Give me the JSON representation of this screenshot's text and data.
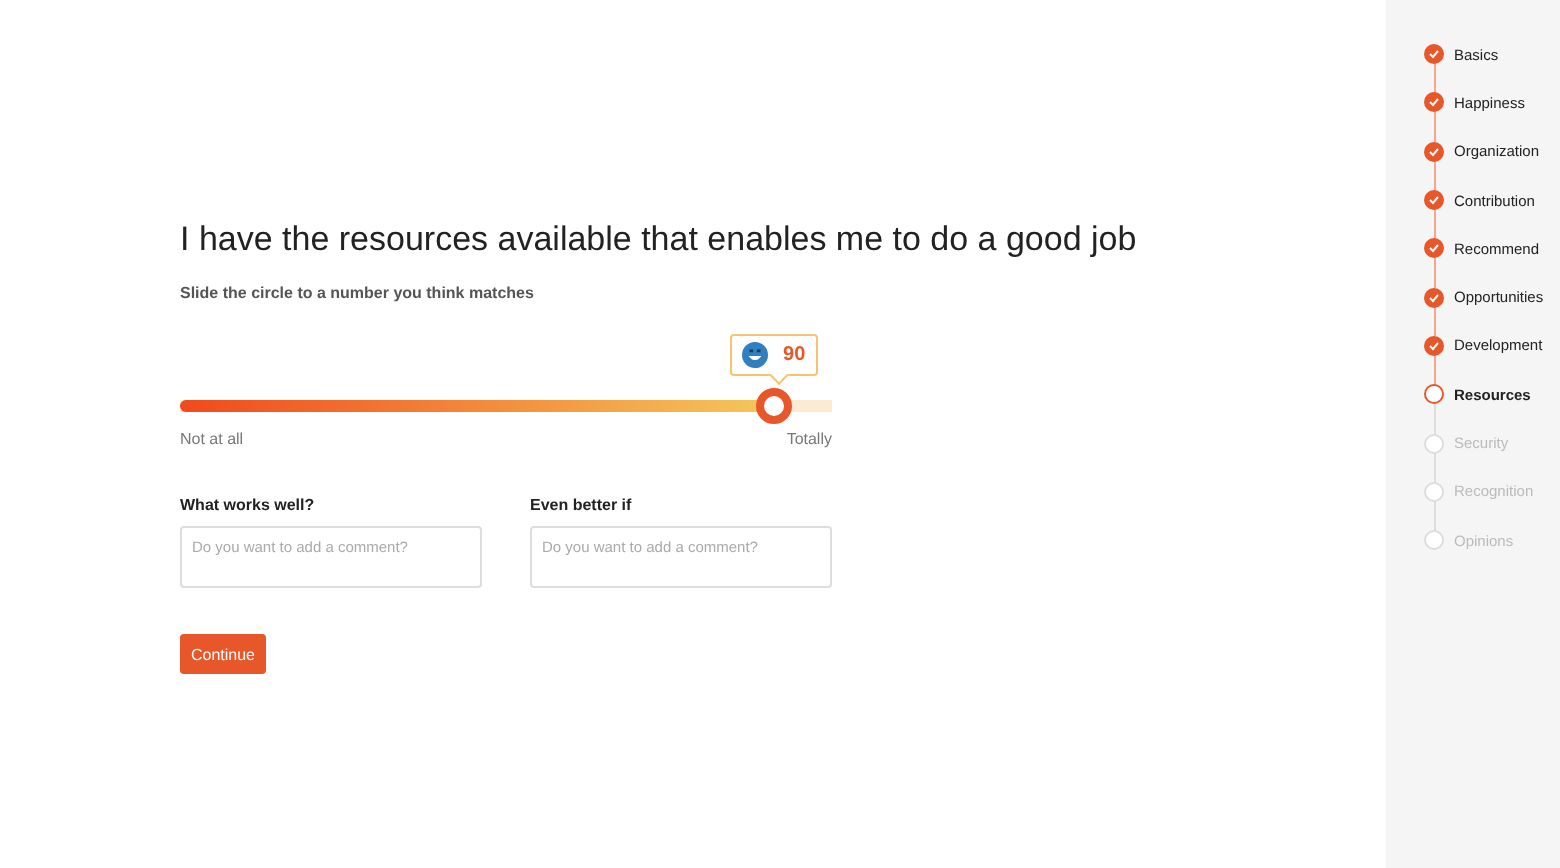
{
  "question": {
    "title": "I have the resources available that enables me to do a good job",
    "instruction": "Slide the circle to a number you think matches"
  },
  "slider": {
    "level": 0.91,
    "value": "90",
    "min_label": "Not at all",
    "max_label": "Totally"
  },
  "comments": [
    {
      "label": "What works well?",
      "placeholder": "Do you want to add a comment?"
    },
    {
      "label": "Even better if",
      "placeholder": "Do you want to add a comment?"
    }
  ],
  "continue_button": "Continue",
  "steps": [
    {
      "label": "Basics",
      "checked": true,
      "selected": false
    },
    {
      "label": "Happiness",
      "checked": true,
      "selected": false
    },
    {
      "label": "Organization",
      "checked": true,
      "selected": false
    },
    {
      "label": "Contribution",
      "checked": true,
      "selected": false
    },
    {
      "label": "Recommend",
      "checked": true,
      "selected": false
    },
    {
      "label": "Opportunities",
      "checked": true,
      "selected": false
    },
    {
      "label": "Development",
      "checked": true,
      "selected": false
    },
    {
      "label": "Resources",
      "checked": false,
      "selected": true
    },
    {
      "label": "Security",
      "checked": false,
      "selected": false
    },
    {
      "label": "Recognition",
      "checked": false,
      "selected": false
    },
    {
      "label": "Opinions",
      "checked": false,
      "selected": false
    }
  ]
}
